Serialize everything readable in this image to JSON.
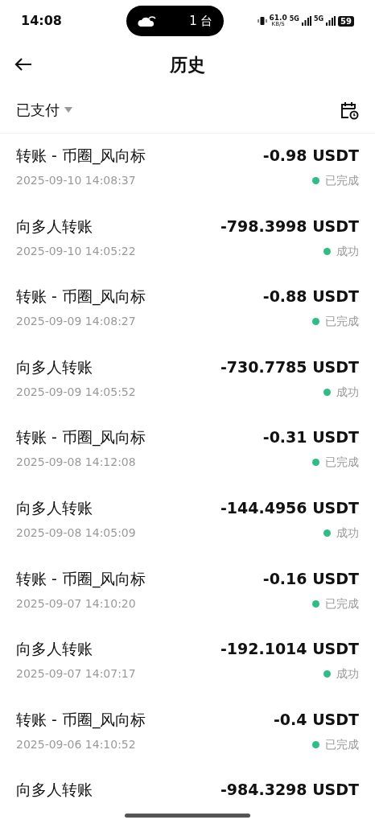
{
  "status_bar": {
    "time": "14:08",
    "pill_text": "1 台",
    "speed": "61.0",
    "speed_unit": "KB/S",
    "network_1": "5G",
    "network_2": "5G",
    "battery": "59"
  },
  "header": {
    "title": "历史"
  },
  "filter": {
    "label": "已支付"
  },
  "transactions": [
    {
      "title": "转账 - 币圈_风向标",
      "amount": "-0.98 USDT",
      "date": "2025-09-10 14:08:37",
      "status": "已完成"
    },
    {
      "title": "向多人转账",
      "amount": "-798.3998 USDT",
      "date": "2025-09-10 14:05:22",
      "status": "成功"
    },
    {
      "title": "转账 - 币圈_风向标",
      "amount": "-0.88 USDT",
      "date": "2025-09-09 14:08:27",
      "status": "已完成"
    },
    {
      "title": "向多人转账",
      "amount": "-730.7785 USDT",
      "date": "2025-09-09 14:05:52",
      "status": "成功"
    },
    {
      "title": "转账 - 币圈_风向标",
      "amount": "-0.31 USDT",
      "date": "2025-09-08 14:12:08",
      "status": "已完成"
    },
    {
      "title": "向多人转账",
      "amount": "-144.4956 USDT",
      "date": "2025-09-08 14:05:09",
      "status": "成功"
    },
    {
      "title": "转账 - 币圈_风向标",
      "amount": "-0.16 USDT",
      "date": "2025-09-07 14:10:20",
      "status": "已完成"
    },
    {
      "title": "向多人转账",
      "amount": "-192.1014 USDT",
      "date": "2025-09-07 14:07:17",
      "status": "成功"
    },
    {
      "title": "转账 - 币圈_风向标",
      "amount": "-0.4 USDT",
      "date": "2025-09-06 14:10:52",
      "status": "已完成"
    },
    {
      "title": "向多人转账",
      "amount": "-984.3298 USDT"
    }
  ]
}
